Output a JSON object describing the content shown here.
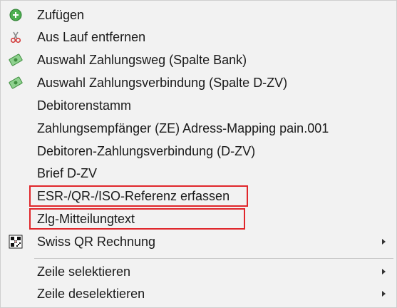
{
  "menu": {
    "items": [
      {
        "label": "Zufügen",
        "icon": "add-circle-icon"
      },
      {
        "label": "Aus Lauf entfernen",
        "icon": "scissors-icon"
      },
      {
        "label": "Auswahl Zahlungsweg  (Spalte Bank)",
        "icon": "money-icon"
      },
      {
        "label": "Auswahl Zahlungsverbindung (Spalte D-ZV)",
        "icon": "money-icon"
      },
      {
        "label": "Debitorenstamm"
      },
      {
        "label": "Zahlungsempfänger (ZE) Adress-Mapping pain.001"
      },
      {
        "label": "Debitoren-Zahlungsverbindung (D-ZV)"
      },
      {
        "label": "Brief D-ZV"
      },
      {
        "label": "ESR-/QR-/ISO-Referenz erfassen",
        "highlighted": true
      },
      {
        "label": "Zlg-Mitteilungtext",
        "highlighted": true
      },
      {
        "label": "Swiss QR Rechnung",
        "icon": "qr-code-icon",
        "submenu": true
      },
      {
        "label": "Zeile selektieren",
        "submenu": true
      },
      {
        "label": "Zeile deselektieren",
        "submenu": true
      }
    ]
  },
  "colors": {
    "background": "#f2f2f2",
    "highlight_border": "#e0262b",
    "add_icon": "#4caf50",
    "money_icon": "#6db46d",
    "scissors_red": "#d23a3a"
  }
}
